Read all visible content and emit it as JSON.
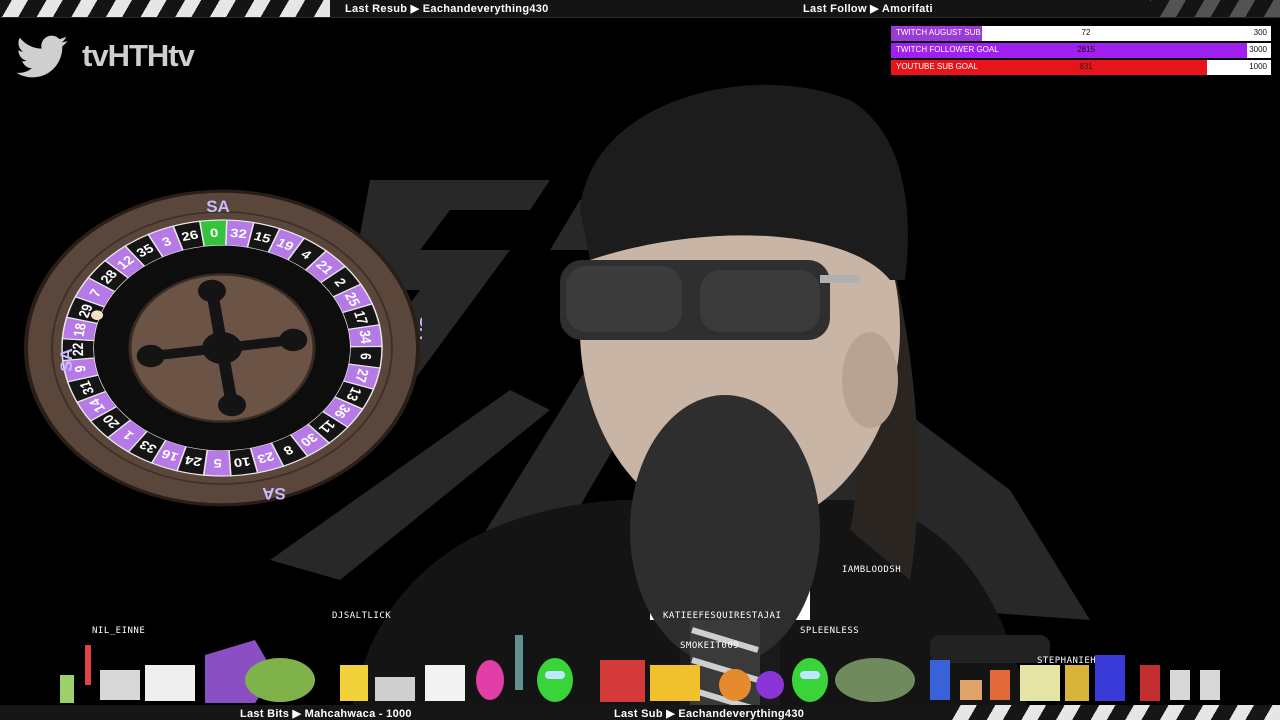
{
  "top_ticker": {
    "last_resub": "Last Resub ▶ Eachandeverything430",
    "last_follow": "Last Follow ▶ Amorifati"
  },
  "social": {
    "twitter_handle": "tvHTHtv"
  },
  "goals": [
    {
      "title": "TWITCH AUGUST SUB GOAL",
      "current": "72",
      "max": "300",
      "progress": 0.24,
      "color": "#9b3bd6"
    },
    {
      "title": "TWITCH FOLLOWER GOAL",
      "current": "2815",
      "max": "3000",
      "progress": 0.938,
      "color": "#a020f0"
    },
    {
      "title": "YOUTUBE SUB GOAL",
      "current": "831",
      "max": "1000",
      "progress": 0.831,
      "color": "#e8141b"
    }
  ],
  "roulette": {
    "label": "SA",
    "numbers": [
      "0",
      "32",
      "15",
      "19",
      "4",
      "21",
      "2",
      "25",
      "17",
      "34",
      "6",
      "27",
      "13",
      "36",
      "11",
      "30",
      "8",
      "23",
      "10",
      "5",
      "24",
      "16",
      "33",
      "1",
      "20",
      "14",
      "31",
      "9",
      "22",
      "18",
      "29",
      "7",
      "28",
      "12",
      "35",
      "3",
      "26"
    ],
    "colors": {
      "green": "#35c23d",
      "purple": "#b57ae6",
      "black": "#151515",
      "wood": "#5a463a"
    }
  },
  "chat_names": [
    "NIL_EINNE",
    "DJSALTLICK",
    "KATIEEFESQUIRESTAJAI",
    "SMOKEIT009",
    "SPLEENLESS",
    "IAMBLOODSH",
    "STEPHANIEH"
  ],
  "bottom_ticker": {
    "last_bits": "Last Bits ▶ Mahcahwaca - 1000",
    "last_sub": "Last Sub ▶ Eachandeverything430"
  }
}
